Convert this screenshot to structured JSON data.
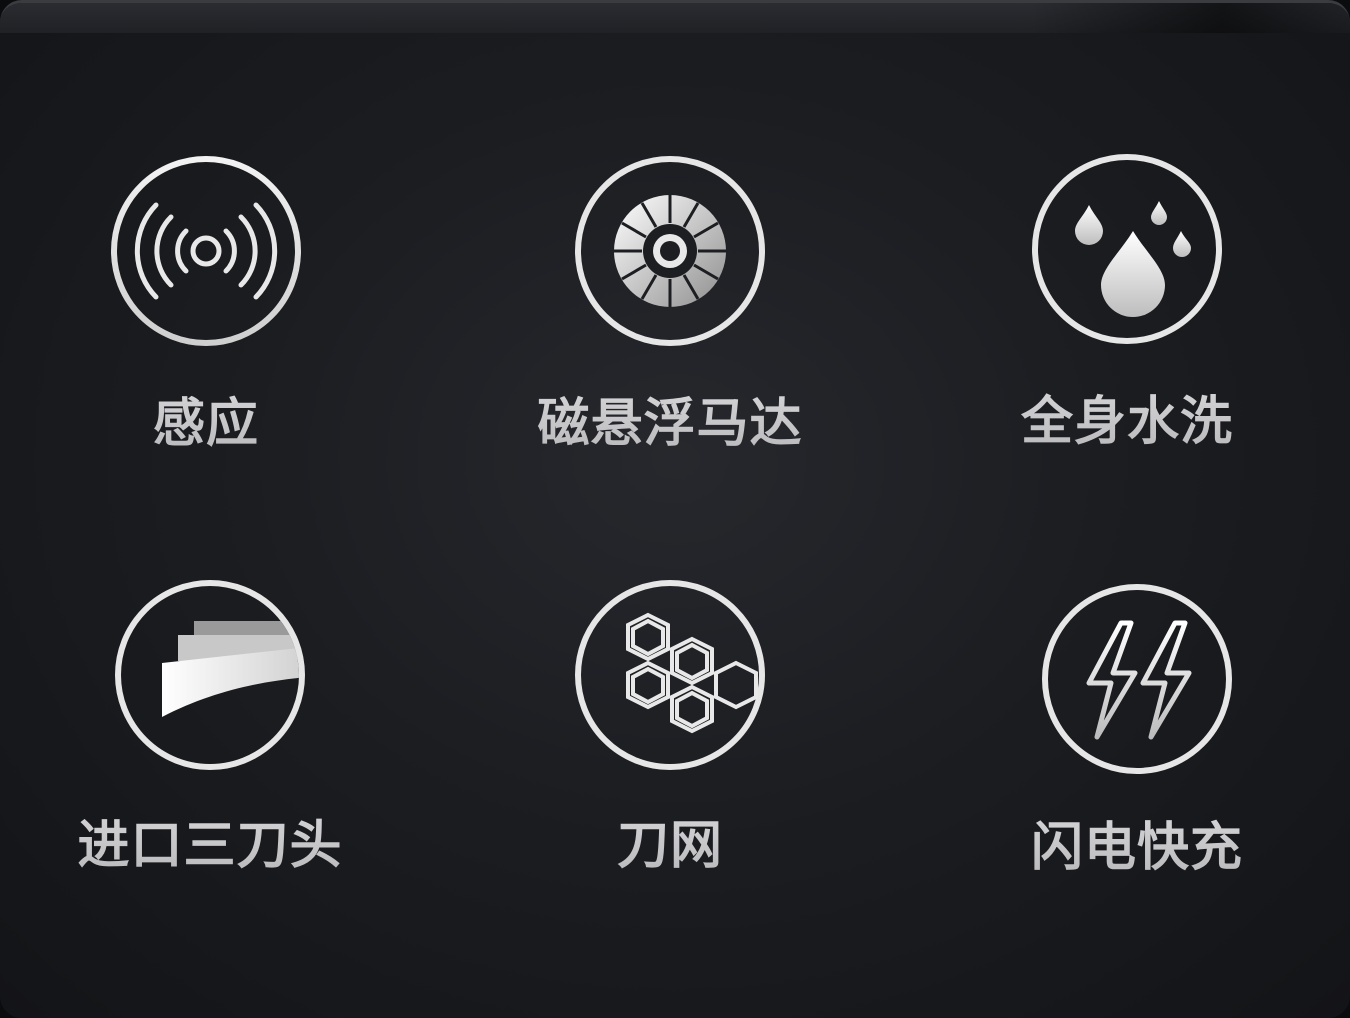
{
  "features": [
    {
      "label": "感应",
      "icon": "sensor-waves-icon"
    },
    {
      "label": "磁悬浮马达",
      "icon": "maglev-motor-icon"
    },
    {
      "label": "全身水洗",
      "icon": "water-drops-icon"
    },
    {
      "label": "进口三刀头",
      "icon": "blade-head-icon"
    },
    {
      "label": "刀网",
      "icon": "hexagon-mesh-icon"
    },
    {
      "label": "闪电快充",
      "icon": "lightning-charge-icon"
    }
  ],
  "colors": {
    "background": "#1b1d21",
    "ring": "#e6e6e6",
    "label": "#c9c9cb"
  }
}
